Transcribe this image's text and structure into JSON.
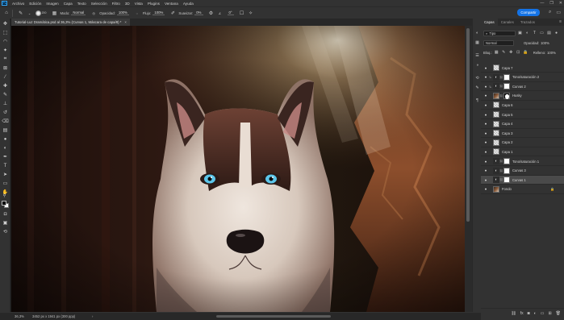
{
  "app": {
    "logo": "Ps"
  },
  "menu": [
    "Archivo",
    "Edición",
    "Imagen",
    "Capa",
    "Texto",
    "Selección",
    "Filtro",
    "3D",
    "Vista",
    "Plugins",
    "Ventana",
    "Ayuda"
  ],
  "window_controls": [
    "—",
    "❐",
    "✕"
  ],
  "options_bar": {
    "brush_size": "200",
    "mode_label": "Modo:",
    "mode_value": "Normal",
    "opacity_label": "Opacidad:",
    "opacity_value": "100%",
    "flow_label": "Flujo:",
    "flow_value": "100%",
    "smoothing_label": "Suavizar:",
    "smoothing_value": "0%",
    "angle_value": "0°",
    "share_label": "Compartir"
  },
  "document": {
    "tab_title": "Tutorial-Luz Dramática.psd al 36,3% (Curvas 1, Máscara de capa/8) *",
    "close": "×"
  },
  "status_bar": {
    "zoom": "36,3%",
    "doc_info": "3452 px x 1941 px (300 ppp)",
    "arrow": "›"
  },
  "layers_panel": {
    "tabs": [
      "Capas",
      "Canales",
      "Trazados"
    ],
    "active_tab": "Capas",
    "filter_label": "Tipo",
    "blend_mode": "Normal",
    "opacity_label": "Opacidad:",
    "opacity_value": "100%",
    "lock_label": "Bloq.:",
    "fill_label": "Relleno:",
    "fill_value": "100%",
    "layers": [
      {
        "name": "Capa 7",
        "thumb": "checker",
        "visible": true,
        "selected": false,
        "clipped": false,
        "mask": false,
        "lock": false
      },
      {
        "name": "Tono/saturación 2",
        "thumb": "adj",
        "visible": true,
        "selected": false,
        "clipped": true,
        "mask": true,
        "lock": false
      },
      {
        "name": "Curvas 2",
        "thumb": "adj",
        "visible": true,
        "selected": false,
        "clipped": true,
        "mask": true,
        "lock": false
      },
      {
        "name": "Husky",
        "thumb": "photo",
        "visible": true,
        "selected": false,
        "clipped": false,
        "mask": true,
        "lock": false
      },
      {
        "name": "Capa 6",
        "thumb": "checker",
        "visible": true,
        "selected": false,
        "clipped": false,
        "mask": false,
        "lock": false
      },
      {
        "name": "Capa 5",
        "thumb": "checker",
        "visible": true,
        "selected": false,
        "clipped": false,
        "mask": false,
        "lock": false
      },
      {
        "name": "Capa 4",
        "thumb": "checker",
        "visible": true,
        "selected": false,
        "clipped": false,
        "mask": false,
        "lock": false
      },
      {
        "name": "Capa 3",
        "thumb": "checker",
        "visible": true,
        "selected": false,
        "clipped": false,
        "mask": false,
        "lock": false
      },
      {
        "name": "Capa 2",
        "thumb": "checker",
        "visible": true,
        "selected": false,
        "clipped": false,
        "mask": false,
        "lock": false
      },
      {
        "name": "Capa 1",
        "thumb": "checker",
        "visible": true,
        "selected": false,
        "clipped": false,
        "mask": false,
        "lock": false
      },
      {
        "name": "Tono/saturación 1",
        "thumb": "adj",
        "visible": true,
        "selected": false,
        "clipped": false,
        "mask": true,
        "lock": false
      },
      {
        "name": "Curvas 3",
        "thumb": "adj",
        "visible": true,
        "selected": false,
        "clipped": false,
        "mask": true,
        "lock": false
      },
      {
        "name": "Curvas 1",
        "thumb": "adj",
        "visible": true,
        "selected": true,
        "clipped": false,
        "mask": true,
        "lock": false
      },
      {
        "name": "Fondo",
        "thumb": "photo",
        "visible": true,
        "selected": false,
        "clipped": false,
        "mask": false,
        "lock": true
      }
    ]
  },
  "colors": {
    "accent": "#1473e6",
    "panel": "#323232",
    "selected_layer": "#4a4a4a"
  }
}
